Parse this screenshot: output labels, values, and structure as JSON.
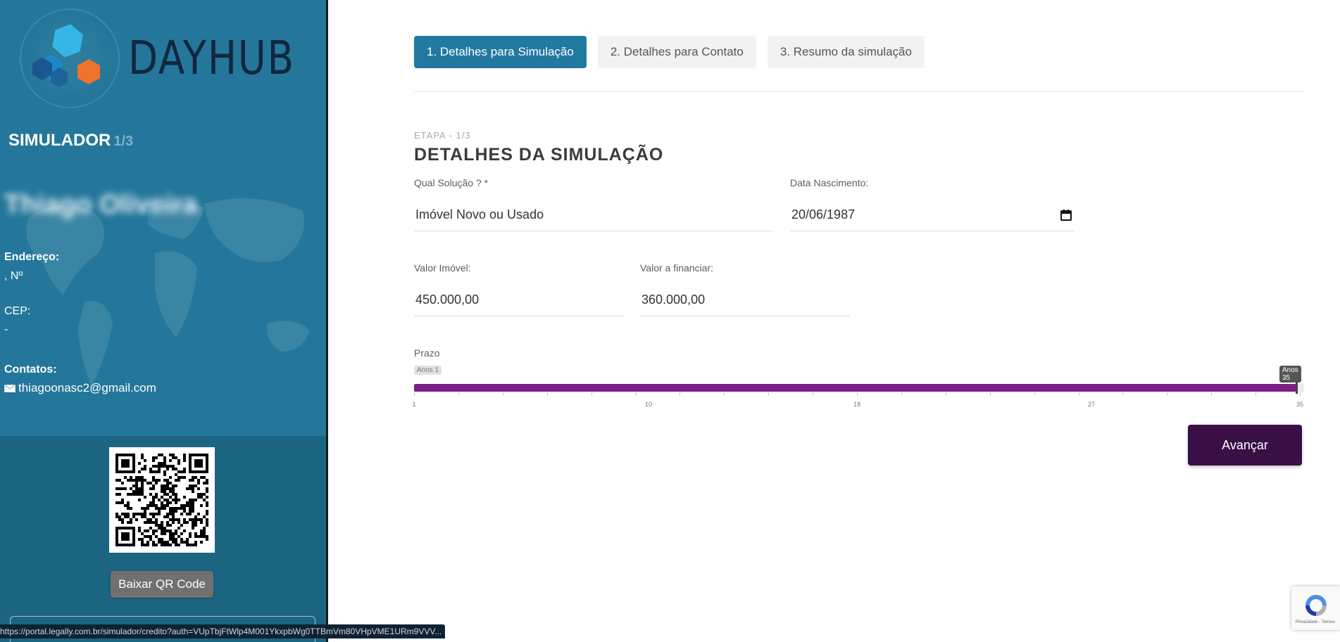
{
  "sidebar": {
    "logo_text": "DAYHUB",
    "title": "SIMULADOR",
    "step": "1/3",
    "user_name": "Thiago Oliveira",
    "address_label": "Endereço:",
    "address_value": ", Nº",
    "cep_label": "CEP:",
    "cep_value": "-",
    "contacts_label": "Contatos:",
    "email": "thiagoonasc2@gmail.com",
    "qr_button": "Baixar QR Code"
  },
  "tabs": [
    {
      "label": "1. Detalhes para Simulação",
      "active": true
    },
    {
      "label": "2. Detalhes para Contato",
      "active": false
    },
    {
      "label": "3. Resumo da simulação",
      "active": false
    }
  ],
  "form": {
    "stage_sub": "ETAPA - 1/3",
    "stage_title": "DETALHES DA SIMULAÇÃO",
    "solution_label": "Qual Solução ? *",
    "solution_value": "Imóvel Novo ou Usado",
    "birth_label": "Data Nascimento:",
    "birth_value": "20/06/1987",
    "property_label": "Valor Imóvel:",
    "property_value": "450.000,00",
    "finance_label": "Valor a financiar:",
    "finance_value": "360.000,00",
    "term_label": "Prazo",
    "term_min_badge": "Anos 1",
    "term_max_badge": "Anos 35",
    "term_value_years": 35,
    "term_range": [
      1,
      35
    ],
    "term_tick_labels": [
      "1",
      "10",
      "18",
      "27",
      "35"
    ],
    "advance_button": "Avançar"
  },
  "status_url": "https://portal.legally.com.br/simulador/credito?auth=VUpTbjFtWlp4M001YkxpbWg0TTBmVm80VHpVME1URm9VVV...",
  "recaptcha_text": "Privacidade - Termos",
  "colors": {
    "sidebar_bg": "#24779a",
    "active_tab": "#2279a0",
    "slider": "#7d1f86",
    "advance_button": "#3a0f45"
  }
}
